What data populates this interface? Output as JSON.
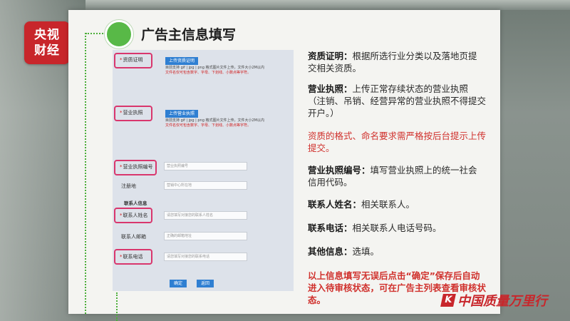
{
  "logo": {
    "line1": "央视",
    "line2": "财经"
  },
  "slide": {
    "title": "广告主信息填写"
  },
  "form": {
    "qualification": {
      "label": "资质证明",
      "button": "上传资质证明",
      "hint1": "目前支持 gif | jpg | png 格式图片文件上传，文件大小2M以内",
      "hint2": "文件名仅可包含数字、字母、下划线、小数点等字符。"
    },
    "license": {
      "label": "营业执照",
      "button": "上传营业执照",
      "hint1": "目前支持 gif | jpg | png 格式图片文件上传，文件大小2M以内",
      "hint2": "文件名仅可包含数字、字母、下划线、小数点等字符。"
    },
    "license_no": {
      "label": "营业执照编号",
      "placeholder": "营业执照编号"
    },
    "address": {
      "label": "注册地",
      "placeholder": "营销中心所在地"
    },
    "contact_section": "联系人信息",
    "contact_name": {
      "label": "联系人姓名",
      "placeholder": "请您填写对接您的联系人姓名"
    },
    "contact_email": {
      "label": "联系人邮箱",
      "placeholder": "正确的邮箱地址"
    },
    "contact_phone": {
      "label": "联系电话",
      "placeholder": "请您填写对接您的联系电话"
    },
    "confirm_button": "确定",
    "back_button": "返回"
  },
  "descriptions": {
    "d1_key": "资质证明：",
    "d1_text": "根据所选行业分类以及落地页提交相关资质。",
    "d2_key": "营业执照：",
    "d2_text": "上传正常存续状态的营业执照（注销、吊销、经营异常的营业执照不得提交开户。）",
    "d3": "资质的格式、命名要求需严格按后台提示上传提交。",
    "d4_key": "营业执照编号：",
    "d4_text": "填写营业执照上的统一社会信用代码。",
    "d5_key": "联系人姓名：",
    "d5_text": "相关联系人。",
    "d6_key": "联系电话：",
    "d6_text": "相关联系人电话号码。",
    "d7_key": "其他信息：",
    "d7_text": "选填。",
    "d8": "以上信息填写无误后点击“确定”保存后自动进入待审核状态，可在广告主列表查看审核状态。"
  },
  "watermark": {
    "mark": "K",
    "text": "中国质量万里行"
  }
}
